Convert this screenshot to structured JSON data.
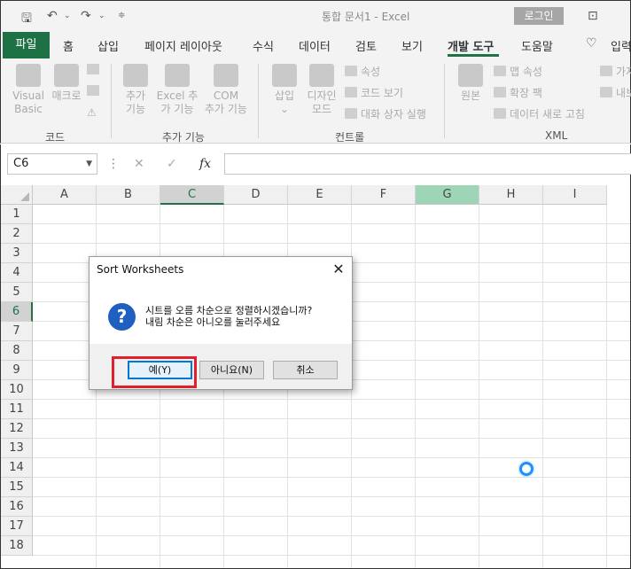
{
  "titlebar": {
    "title": "통합 문서1  -  Excel",
    "login_label": "로그인"
  },
  "tabs": {
    "file": "파일",
    "items": [
      "홈",
      "삽입",
      "페이지 레이아웃",
      "수식",
      "데이터",
      "검토",
      "보기",
      "개발 도구",
      "도움말",
      "입력"
    ],
    "active": "개발 도구"
  },
  "ribbon": {
    "code": {
      "visual_basic": [
        "Visual",
        "Basic"
      ],
      "macro": "매크로",
      "group": "코드"
    },
    "addins": {
      "addins": [
        "추가",
        "기능"
      ],
      "excel_addins": [
        "Excel 추",
        "가 기능"
      ],
      "com_addins": [
        "COM",
        "추가 기능"
      ],
      "group": "추가 기능"
    },
    "controls": {
      "insert": "삽입",
      "design_mode": [
        "디자인",
        "모드"
      ],
      "properties": "속성",
      "view_code": "코드 보기",
      "run_dialog": "대화 상자 실행",
      "group": "컨트롤"
    },
    "xml": {
      "source": "원본",
      "map_properties": "맵 속성",
      "expansion_pack": "확장 팩",
      "refresh_data": "데이터 새로 고침",
      "import": "가져",
      "export": "내보",
      "group": "XML"
    }
  },
  "formula_bar": {
    "name_box": "C6",
    "cancel": "✕",
    "enter": "✓",
    "fx": "fx",
    "value": ""
  },
  "grid": {
    "columns": [
      "A",
      "B",
      "C",
      "D",
      "E",
      "F",
      "G",
      "H",
      "I"
    ],
    "rows": [
      "1",
      "2",
      "3",
      "4",
      "5",
      "6",
      "7",
      "8",
      "9",
      "10",
      "11",
      "12",
      "13",
      "14",
      "15",
      "16",
      "17",
      "18"
    ],
    "selected_column": "C",
    "highlighted_column": "G",
    "selected_row": "6"
  },
  "dialog": {
    "title": "Sort Worksheets",
    "close": "✕",
    "icon": "?",
    "message_line1": "시트를 오름 차순으로 정렬하시겠습니까?",
    "message_line2": "내림 차순은 아니오를 눌러주세요",
    "yes": "예(Y)",
    "no": "아니요(N)",
    "cancel": "취소"
  },
  "colors": {
    "excel_green": "#217346",
    "file_tab": "#1e7145",
    "highlight_red": "#e0202a",
    "question_blue": "#1f5fbf"
  }
}
